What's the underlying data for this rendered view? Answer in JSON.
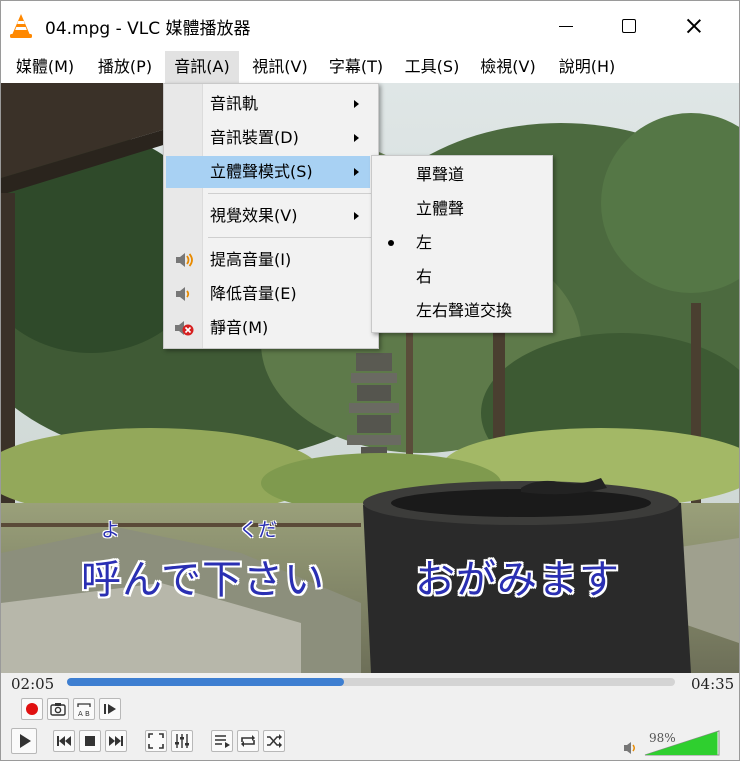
{
  "window": {
    "title": "04.mpg - VLC 媒體播放器"
  },
  "menubar": {
    "items": [
      {
        "label": "媒體(M)"
      },
      {
        "label": "播放(P)"
      },
      {
        "label": "音訊(A)"
      },
      {
        "label": "視訊(V)"
      },
      {
        "label": "字幕(T)"
      },
      {
        "label": "工具(S)"
      },
      {
        "label": "檢視(V)"
      },
      {
        "label": "說明(H)"
      }
    ]
  },
  "audio_menu": {
    "items": [
      {
        "label": "音訊軌"
      },
      {
        "label": "音訊裝置(D)"
      },
      {
        "label": "立體聲模式(S)"
      },
      {
        "label": "視覺效果(V)"
      },
      {
        "label": "提高音量(I)",
        "icon": "volume-up-icon"
      },
      {
        "label": "降低音量(E)",
        "icon": "volume-down-icon"
      },
      {
        "label": "靜音(M)",
        "icon": "mute-icon"
      }
    ]
  },
  "stereo_submenu": {
    "items": [
      {
        "label": "單聲道"
      },
      {
        "label": "立體聲"
      },
      {
        "label": "左",
        "checked": true
      },
      {
        "label": "右"
      },
      {
        "label": "左右聲道交換"
      }
    ]
  },
  "video": {
    "lyric_main": "呼んで下さい",
    "lyric_second": "おがみます",
    "ruby_1": "よ",
    "ruby_2": "くだ"
  },
  "controls": {
    "elapsed": "02:05",
    "total": "04:35",
    "progress": 0.455,
    "volume_text": "98%",
    "volume": 0.98
  },
  "colors": {
    "accent": "#3e7fd1",
    "menu_highlight": "#a8d1f3",
    "lyric_color": "#2a2fb3",
    "volume_green": "#2fcf2f"
  }
}
